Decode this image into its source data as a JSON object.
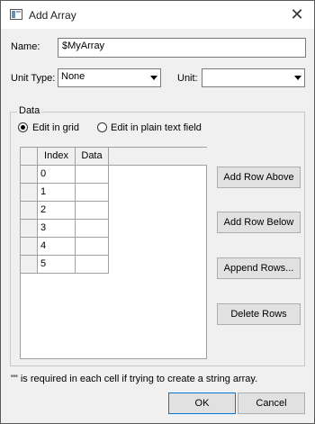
{
  "window": {
    "title": "Add Array"
  },
  "name_field": {
    "label": "Name:",
    "value": "$MyArray"
  },
  "unit_type": {
    "label": "Unit Type:",
    "value": "None"
  },
  "unit": {
    "label": "Unit:",
    "value": ""
  },
  "data_group": {
    "label": "Data",
    "radio_grid_label": "Edit in grid",
    "radio_text_label": "Edit in plain text field",
    "selected": "grid"
  },
  "grid": {
    "columns": [
      "Index",
      "Data"
    ],
    "rows": [
      {
        "index": "0",
        "data": ""
      },
      {
        "index": "1",
        "data": ""
      },
      {
        "index": "2",
        "data": ""
      },
      {
        "index": "3",
        "data": ""
      },
      {
        "index": "4",
        "data": ""
      },
      {
        "index": "5",
        "data": ""
      }
    ]
  },
  "side_buttons": {
    "add_row_above": "Add Row Above",
    "add_row_below": "Add Row Below",
    "append_rows": "Append Rows...",
    "delete_rows": "Delete Rows"
  },
  "note": "\"\" is required in each cell if trying to create a string array.",
  "footer": {
    "ok": "OK",
    "cancel": "Cancel"
  }
}
